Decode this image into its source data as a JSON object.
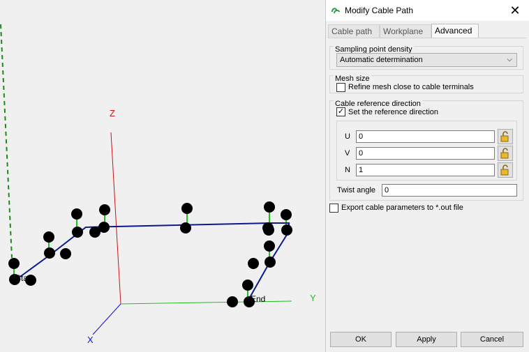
{
  "viewport": {
    "axis_labels": {
      "z": "Z",
      "y": "Y",
      "x": "X"
    },
    "start_label": "Start",
    "end_label": "End",
    "colors": {
      "z_axis": "#d01010",
      "y_axis": "#20c020",
      "x_axis": "#1010d0",
      "path": "#0a1a8a",
      "guide": "#1a8a1a"
    }
  },
  "dialog": {
    "icon": "cable-app-icon",
    "title": "Modify Cable Path",
    "close_label": "✕",
    "tabs": [
      {
        "label": "Cable path"
      },
      {
        "label": "Workplane"
      },
      {
        "label": "Advanced"
      }
    ],
    "sampling": {
      "title": "Sampling point density",
      "selected": "Automatic determination"
    },
    "mesh": {
      "title": "Mesh size",
      "refine_label": "Refine mesh close to cable terminals",
      "refine_checked": false
    },
    "reference": {
      "title": "Cable reference direction",
      "set_label": "Set the reference direction",
      "set_checked": true,
      "fields": [
        {
          "label": "U",
          "value": "0"
        },
        {
          "label": "V",
          "value": "0"
        },
        {
          "label": "N",
          "value": "1"
        }
      ],
      "twist_label": "Twist angle",
      "twist_value": "0"
    },
    "export_label": "Export cable parameters to *.out file",
    "export_checked": false,
    "buttons": {
      "ok": "OK",
      "apply": "Apply",
      "cancel": "Cancel"
    }
  }
}
